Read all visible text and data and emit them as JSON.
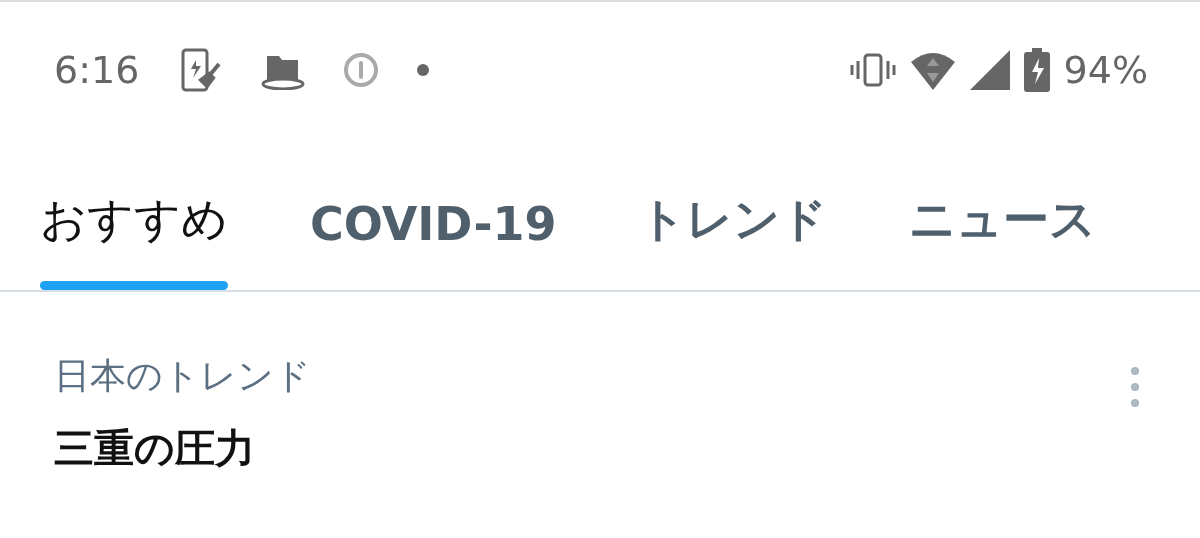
{
  "status_bar": {
    "time": "6:16",
    "battery": "94%"
  },
  "tabs": [
    {
      "label": "おすすめ",
      "selected": true
    },
    {
      "label": "COVID-19",
      "selected": false
    },
    {
      "label": "トレンド",
      "selected": false
    },
    {
      "label": "ニュース",
      "selected": false
    }
  ],
  "trend": {
    "context": "日本のトレンド",
    "title": "三重の圧力"
  }
}
